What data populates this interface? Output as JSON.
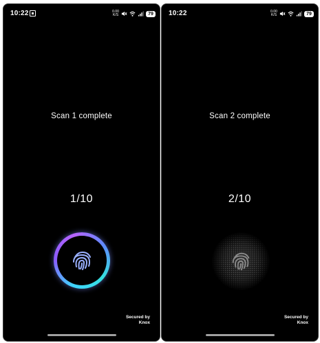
{
  "screens": [
    {
      "status_bar": {
        "time": "10:22",
        "data_speed_top": "0.00",
        "data_speed_bottom": "K/S",
        "battery": "79"
      },
      "scan_message": "Scan 1 complete",
      "progress": "1/10",
      "secured_line1": "Secured by",
      "secured_line2": "Knox"
    },
    {
      "status_bar": {
        "time": "10:22",
        "data_speed_top": "0.00",
        "data_speed_bottom": "K/S",
        "battery": "79"
      },
      "scan_message": "Scan 2 complete",
      "progress": "2/10",
      "secured_line1": "Secured by",
      "secured_line2": "Knox"
    }
  ],
  "colors": {
    "background": "#000000",
    "text": "#ffffff",
    "ring_cyan": "#3fd4ff",
    "ring_purple": "#8a5bff",
    "fingerprint_active": "#9ab0ff",
    "fingerprint_idle": "#8a8a8a"
  },
  "icons": {
    "screenshot": "screenshot-icon",
    "mute": "mute-icon",
    "wifi": "wifi-icon",
    "signal": "signal-icon",
    "fingerprint": "fingerprint-icon"
  }
}
